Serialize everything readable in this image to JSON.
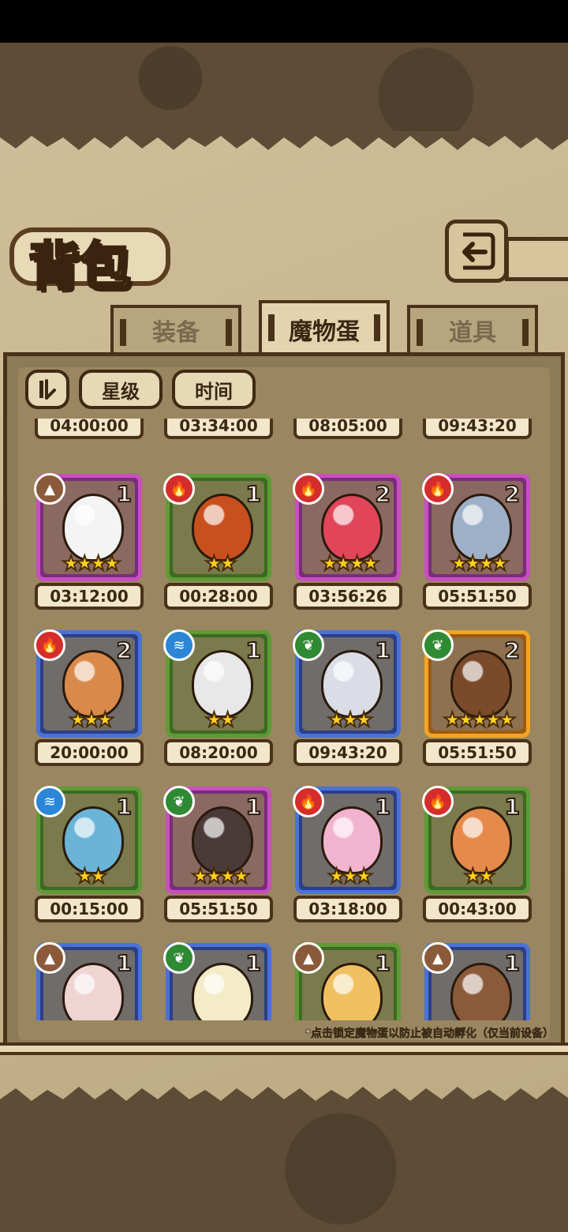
{
  "screen": {
    "title": "背包",
    "back_icon": "return-arrow-icon"
  },
  "tabs": [
    {
      "label": "装备",
      "active": false
    },
    {
      "label": "魔物蛋",
      "active": true
    },
    {
      "label": "道具",
      "active": false
    }
  ],
  "filters": {
    "sort_toggle_icon": "sort-toggle-icon",
    "star_label": "星级",
    "time_label": "时间"
  },
  "partial_top_row": [
    {
      "time": "04:00:00",
      "frame": "green"
    },
    {
      "time": "03:34:00",
      "frame": "blue"
    },
    {
      "time": "08:05:00",
      "frame": "green"
    },
    {
      "time": "09:43:20",
      "frame": "green"
    }
  ],
  "eggs": [
    {
      "element": "earth",
      "count": "1",
      "stars": 4,
      "time": "03:12:00",
      "frame": "purple",
      "color": "#f4f4f4"
    },
    {
      "element": "fire",
      "count": "1",
      "stars": 2,
      "time": "00:28:00",
      "frame": "green",
      "color": "#c8501e"
    },
    {
      "element": "fire",
      "count": "2",
      "stars": 4,
      "time": "03:56:26",
      "frame": "purple",
      "color": "#e0455a"
    },
    {
      "element": "fire",
      "count": "2",
      "stars": 4,
      "time": "05:51:50",
      "frame": "purple",
      "color": "#9db0c8"
    },
    {
      "element": "fire",
      "count": "2",
      "stars": 3,
      "time": "20:00:00",
      "frame": "blue",
      "color": "#d98a4a"
    },
    {
      "element": "water",
      "count": "1",
      "stars": 2,
      "time": "08:20:00",
      "frame": "green",
      "color": "#e8e8e8"
    },
    {
      "element": "wood",
      "count": "1",
      "stars": 3,
      "time": "09:43:20",
      "frame": "blue",
      "color": "#dadde6"
    },
    {
      "element": "wood",
      "count": "2",
      "stars": 5,
      "time": "05:51:50",
      "frame": "gold",
      "color": "#7a4a2a"
    },
    {
      "element": "water",
      "count": "1",
      "stars": 2,
      "time": "00:15:00",
      "frame": "green",
      "color": "#6ab4d8"
    },
    {
      "element": "wood",
      "count": "1",
      "stars": 4,
      "time": "05:51:50",
      "frame": "purple",
      "color": "#4a3a38"
    },
    {
      "element": "fire",
      "count": "1",
      "stars": 3,
      "time": "03:18:00",
      "frame": "blue",
      "color": "#f2b3cf"
    },
    {
      "element": "fire",
      "count": "1",
      "stars": 2,
      "time": "00:43:00",
      "frame": "green",
      "color": "#e58a4a"
    },
    {
      "element": "earth",
      "count": "1",
      "stars": 0,
      "time": "",
      "frame": "blue",
      "color": "#f0d4d4"
    },
    {
      "element": "wood",
      "count": "1",
      "stars": 0,
      "time": "",
      "frame": "blue",
      "color": "#f4ecc8"
    },
    {
      "element": "earth",
      "count": "1",
      "stars": 0,
      "time": "",
      "frame": "green",
      "color": "#f0c060"
    },
    {
      "element": "earth",
      "count": "1",
      "stars": 0,
      "time": "",
      "frame": "blue",
      "color": "#8a5a3a"
    }
  ],
  "hint": "*点击锁定魔物蛋以防止被自动孵化（仅当前设备）"
}
